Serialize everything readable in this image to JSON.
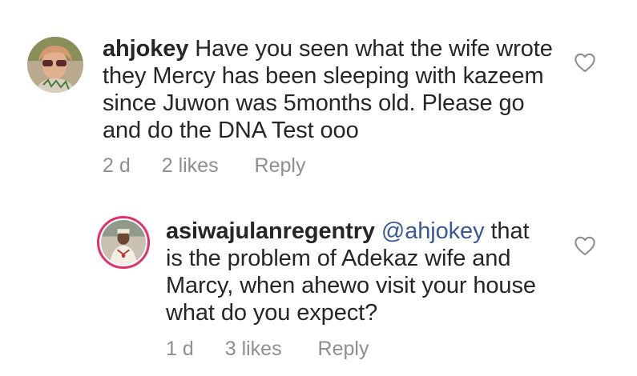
{
  "comments": [
    {
      "username": "ahjokey",
      "mention": "",
      "text": "Have you seen what the wife wrote they Mercy has been sleeping with kazeem since Juwon was 5months old. Please go and do the DNA Test ooo",
      "time": "2 d",
      "likes": "2 likes",
      "reply": "Reply",
      "avatar_icon": "avatar-woman-sunglasses",
      "like_icon": "heart-outline-icon"
    },
    {
      "username": "asiwajulanregentry",
      "mention": "@ahjokey",
      "text": "that is the problem of Adekaz wife and Marcy, when ahewo visit your house what do you expect?",
      "time": "1 d",
      "likes": "3 likes",
      "reply": "Reply",
      "avatar_icon": "avatar-man-traditional",
      "like_icon": "heart-outline-icon"
    }
  ],
  "colors": {
    "text": "#262626",
    "meta": "#8e8e8e",
    "mention": "#385898",
    "avatar_ring": "#e1306c"
  }
}
